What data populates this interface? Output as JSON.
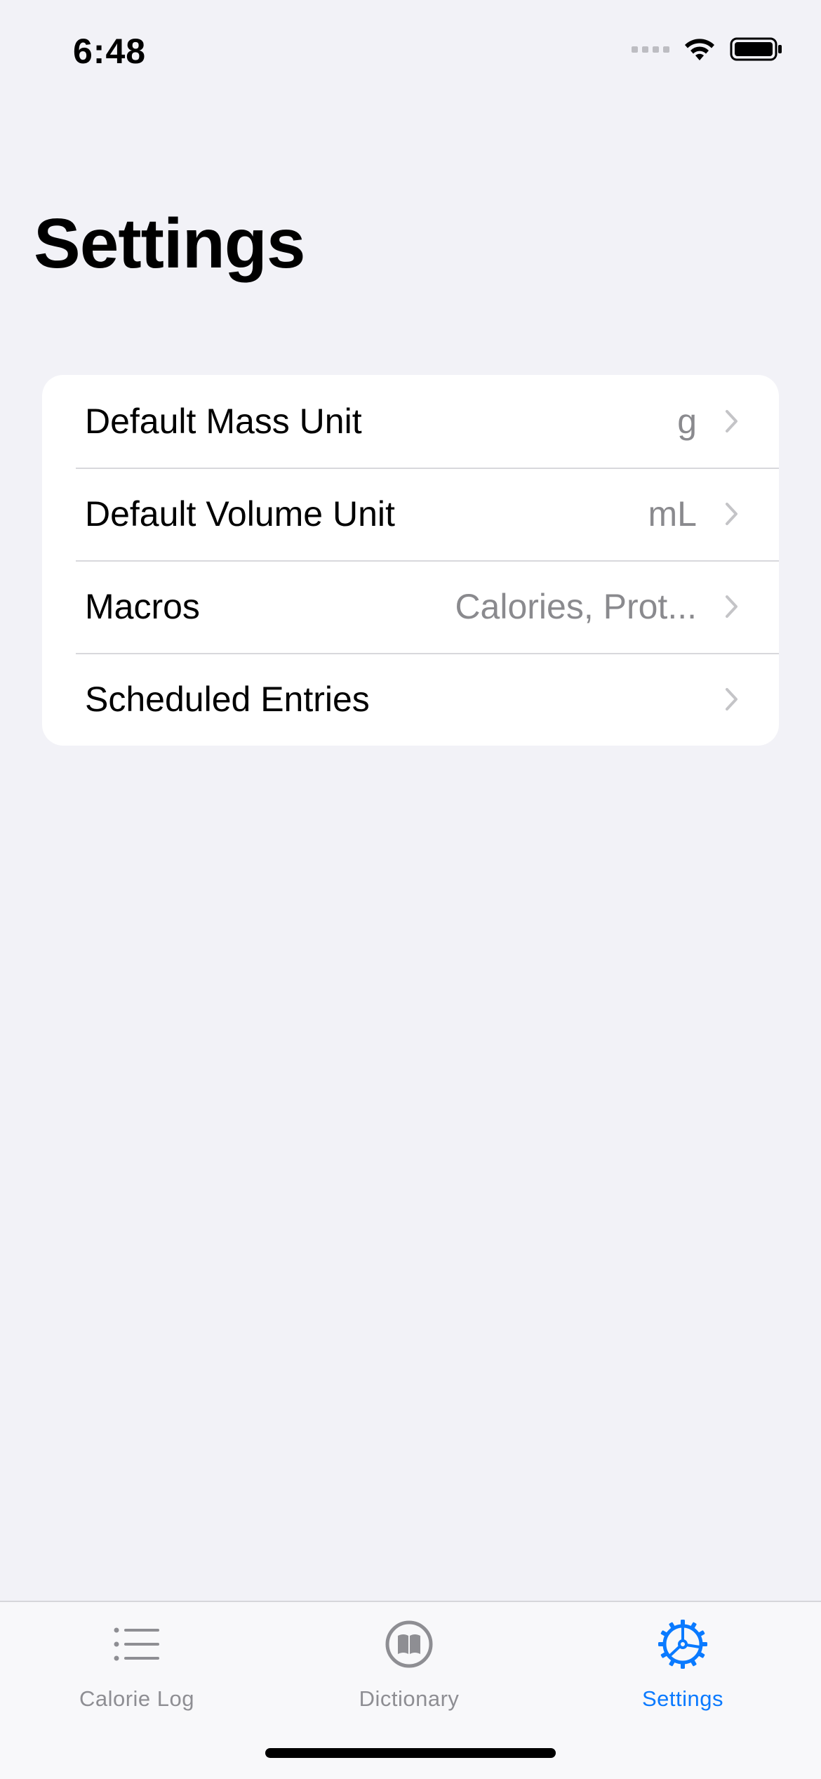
{
  "status_bar": {
    "time": "6:48",
    "icons": [
      "signal-icon",
      "wifi-icon",
      "battery-icon"
    ]
  },
  "header": {
    "title": "Settings"
  },
  "settings": {
    "rows": [
      {
        "label": "Default Mass Unit",
        "value": "g"
      },
      {
        "label": "Default Volume Unit",
        "value": "mL"
      },
      {
        "label": "Macros",
        "value": "Calories, Prot..."
      },
      {
        "label": "Scheduled Entries",
        "value": ""
      }
    ]
  },
  "tab_bar": {
    "tabs": [
      {
        "label": "Calorie Log",
        "icon": "list-icon",
        "active": false
      },
      {
        "label": "Dictionary",
        "icon": "book-icon",
        "active": false
      },
      {
        "label": "Settings",
        "icon": "gear-icon",
        "active": true
      }
    ]
  },
  "colors": {
    "background": "#f2f2f7",
    "accent": "#0a7aff",
    "secondary_text": "#8a8a8e",
    "tab_inactive": "#8e8e93"
  }
}
